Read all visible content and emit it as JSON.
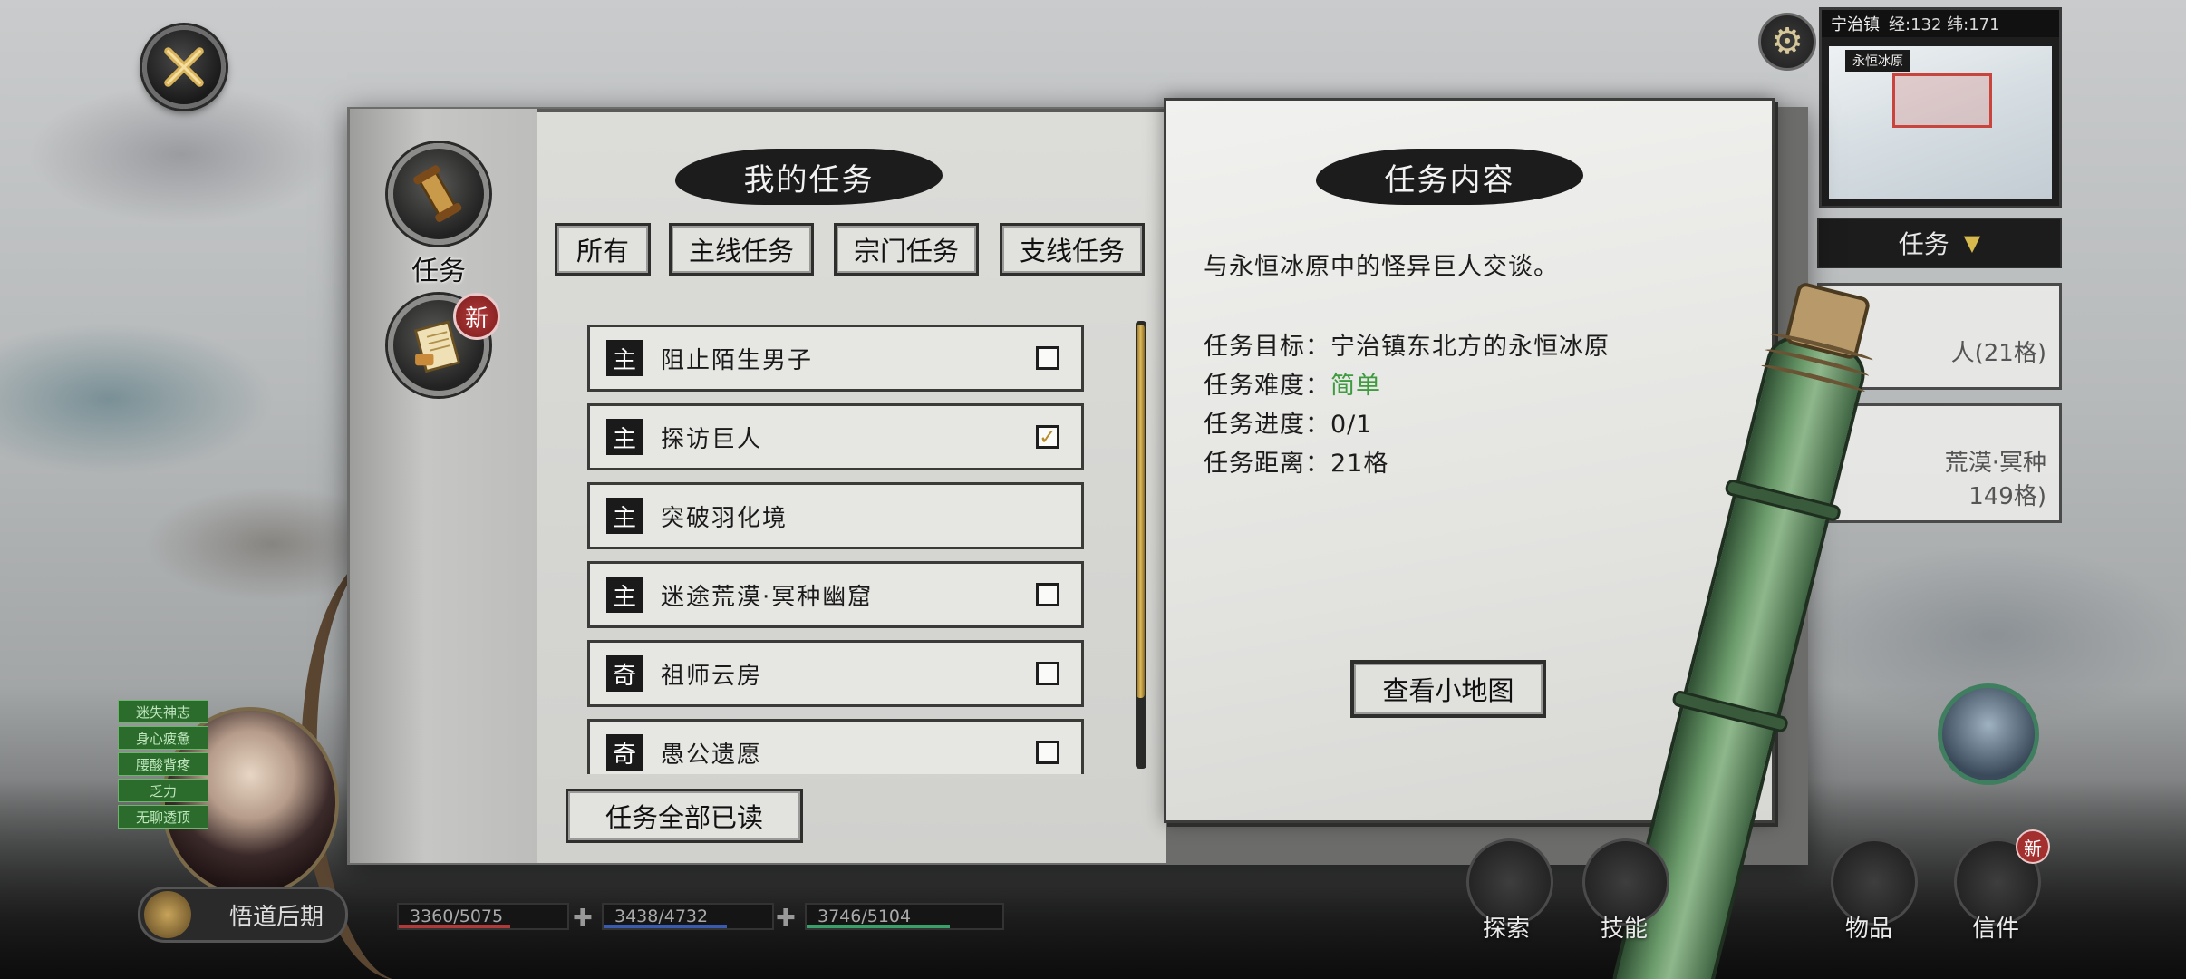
{
  "panel": {
    "side_nav": {
      "quests_label": "任务",
      "mail_badge": "新"
    },
    "quest_list": {
      "title": "我的任务",
      "tabs": [
        {
          "label": "所有",
          "active": true
        },
        {
          "label": "主线任务",
          "active": false
        },
        {
          "label": "宗门任务",
          "active": false
        },
        {
          "label": "支线任务",
          "active": false
        }
      ],
      "quests": [
        {
          "type": "主",
          "name": "阻止陌生男子",
          "checkbox": true,
          "checked": false
        },
        {
          "type": "主",
          "name": "探访巨人",
          "checkbox": true,
          "checked": true
        },
        {
          "type": "主",
          "name": "突破羽化境",
          "checkbox": false,
          "checked": false
        },
        {
          "type": "主",
          "name": "迷途荒漠·冥种幽窟",
          "checkbox": true,
          "checked": false
        },
        {
          "type": "奇",
          "name": "祖师云房",
          "checkbox": true,
          "checked": false
        },
        {
          "type": "奇",
          "name": "愚公遗愿",
          "checkbox": true,
          "checked": false
        }
      ],
      "mark_all_read": "任务全部已读"
    },
    "quest_detail": {
      "title": "任务内容",
      "description": "与永恒冰原中的怪异巨人交谈。",
      "rows": [
        {
          "label": "任务目标：",
          "value": "宁治镇东北方的永恒冰原"
        },
        {
          "label": "任务难度：",
          "value": "简单"
        },
        {
          "label": "任务进度：",
          "value": "0/1"
        },
        {
          "label": "任务距离：",
          "value": "21格"
        }
      ],
      "view_minimap": "查看小地图"
    }
  },
  "hud": {
    "minimap": {
      "location": "宁治镇",
      "coords": "经:132 纬:171",
      "tag": "永恒冰原"
    },
    "tracker": {
      "header": "任务",
      "card1": "人(21格)",
      "card2_line1": "荒漠·冥种",
      "card2_line2": "149格)"
    },
    "player": {
      "status_chips": [
        "迷失神志",
        "身心疲惫",
        "腰酸背疼",
        "乏力",
        "无聊透顶"
      ],
      "realm": "悟道后期",
      "hp": "3360/5075",
      "mp": "3438/4732",
      "sp": "3746/5104"
    },
    "bottom_menu": {
      "explore": "探索",
      "skills": "技能",
      "items": "物品",
      "mail": "信件",
      "mail_badge": "新"
    }
  },
  "colors": {
    "difficulty_easy": "#3f9b3f",
    "scroll_thumb": "#e0bb5b",
    "badge_red": "#a42f2f"
  }
}
